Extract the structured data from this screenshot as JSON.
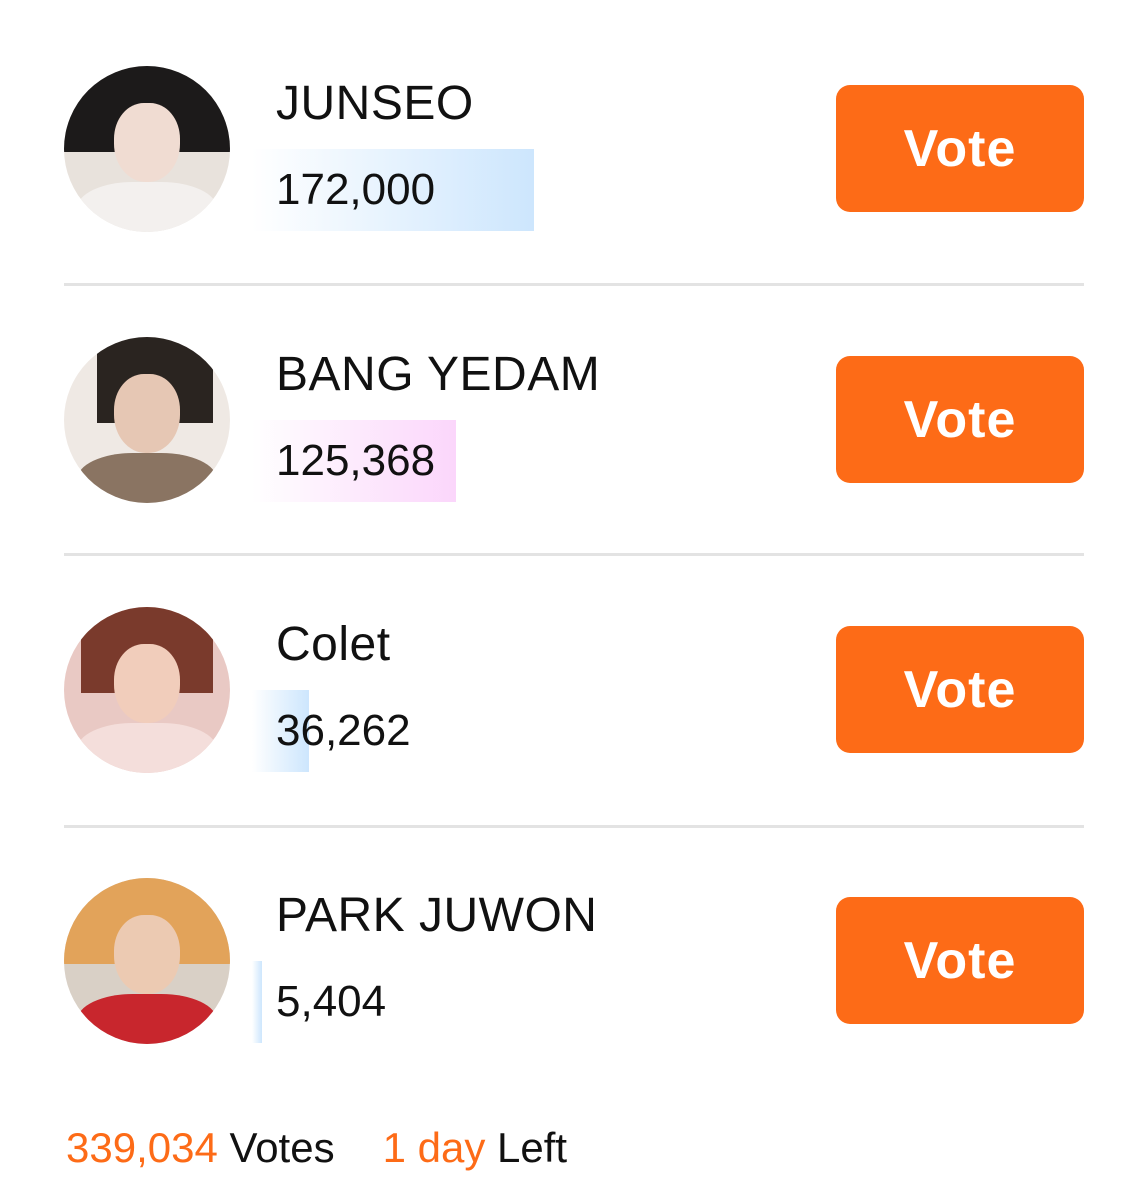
{
  "accent_color": "#fd6b17",
  "candidates": [
    {
      "name": "JUNSEO",
      "votes": "172,000",
      "vote_share": 0.5073,
      "bar_color": "blue",
      "avatar_icon": "avatar-photo",
      "vote_label": "Vote"
    },
    {
      "name": "BANG YEDAM",
      "votes": "125,368",
      "vote_share": 0.3698,
      "bar_color": "pink",
      "avatar_icon": "avatar-photo",
      "vote_label": "Vote"
    },
    {
      "name": "Colet",
      "votes": "36,262",
      "vote_share": 0.107,
      "bar_color": "blue",
      "avatar_icon": "avatar-photo",
      "vote_label": "Vote"
    },
    {
      "name": "PARK JUWON",
      "votes": "5,404",
      "vote_share": 0.0159,
      "bar_color": "blue",
      "avatar_icon": "avatar-photo",
      "vote_label": "Vote"
    }
  ],
  "footer": {
    "total_votes": "339,034",
    "votes_label": "Votes",
    "time_value": "1 day",
    "time_label": "Left"
  }
}
